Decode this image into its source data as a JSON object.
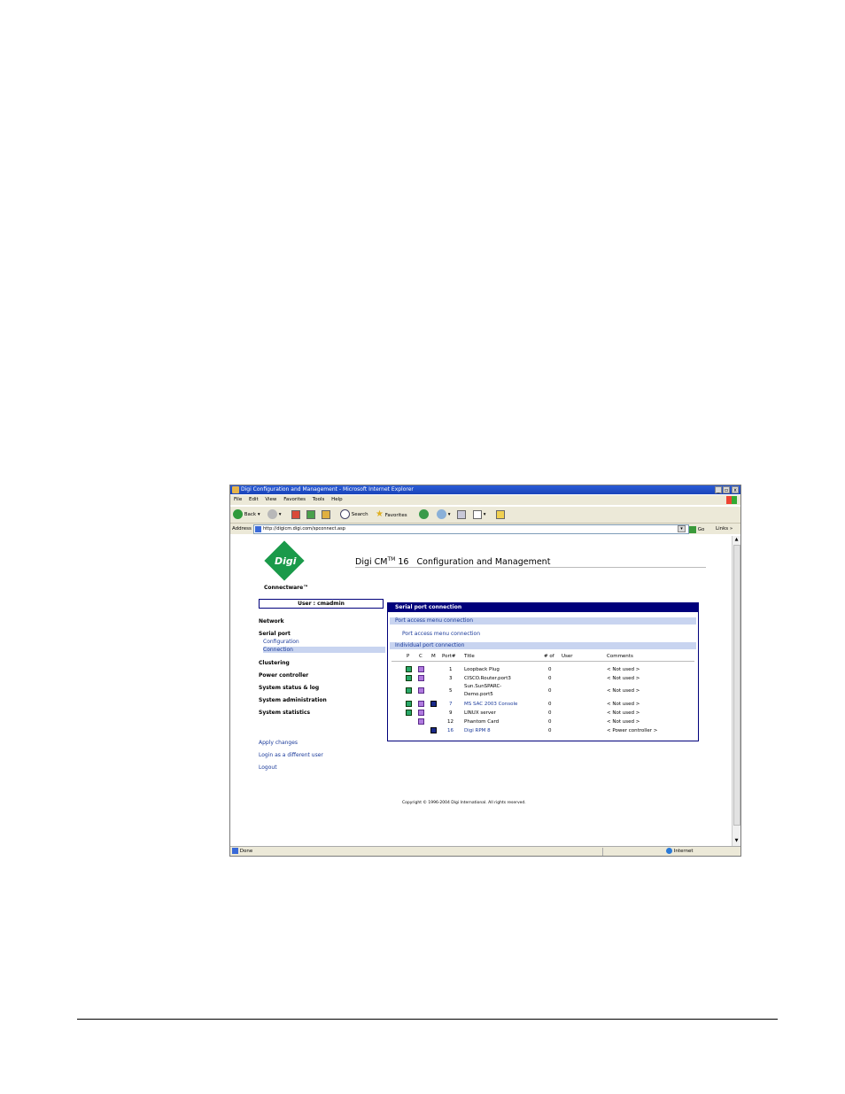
{
  "window": {
    "title": "Digi Configuration and Management - Microsoft Internet Explorer"
  },
  "menu": [
    "File",
    "Edit",
    "View",
    "Favorites",
    "Tools",
    "Help"
  ],
  "toolbar": {
    "back": "Back",
    "search": "Search",
    "favorites": "Favorites"
  },
  "address": {
    "label": "Address",
    "url": "http://digicm.digi.com/spconnect.asp",
    "go": "Go",
    "links": "Links"
  },
  "logo": {
    "text": "Digi",
    "sub": "Connectware™"
  },
  "page": {
    "title_pre": "Digi CM",
    "title_sup": "TM",
    "title_post": " 16   Configuration and Management"
  },
  "user_box": "User : cmadmin",
  "nav": {
    "network": "Network",
    "serial_port": "Serial port",
    "configuration": "Configuration",
    "connection": "Connection",
    "clustering": "Clustering",
    "power_controller": "Power controller",
    "system_status": "System status & log",
    "system_admin": "System administration",
    "system_stats": "System statistics"
  },
  "actions": {
    "apply": "Apply changes",
    "login_diff": "Login as a different user",
    "logout": "Logout"
  },
  "panel": {
    "title": "Serial port connection",
    "section1": "Port access menu connection",
    "link1": "Port access menu connection",
    "section2": "Individual port connection"
  },
  "table": {
    "headers": {
      "p": "P",
      "c": "C",
      "m": "M",
      "port": "Port#",
      "title": "Title",
      "num": "# of",
      "user": "User",
      "comments": "Comments"
    },
    "rows": [
      {
        "port": "1",
        "title": "Loopback Plug",
        "num": "0",
        "comment": "< Not used >"
      },
      {
        "port": "3",
        "title": "CISCO.Router.port3",
        "num": "0",
        "comment": "< Not used >"
      },
      {
        "port": "5",
        "title": "Sun.SunSPARC-",
        "title2": "Demo.port5",
        "num": "0",
        "comment": "< Not used >"
      },
      {
        "port": "7",
        "title": "MS SAC 2003 Console",
        "num": "0",
        "comment": "< Not used >"
      },
      {
        "port": "9",
        "title": "LINUX server",
        "num": "0",
        "comment": "< Not used >"
      },
      {
        "port": "12",
        "title": "Phantom Card",
        "num": "0",
        "comment": "< Not used >"
      },
      {
        "port": "16",
        "title": "Digi RPM 8",
        "num": "0",
        "comment": "< Power controller >"
      }
    ]
  },
  "copyright": "Copyright © 1996-2004 Digi International. All rights reserved.",
  "status": {
    "left": "Done",
    "zone": "Internet"
  }
}
